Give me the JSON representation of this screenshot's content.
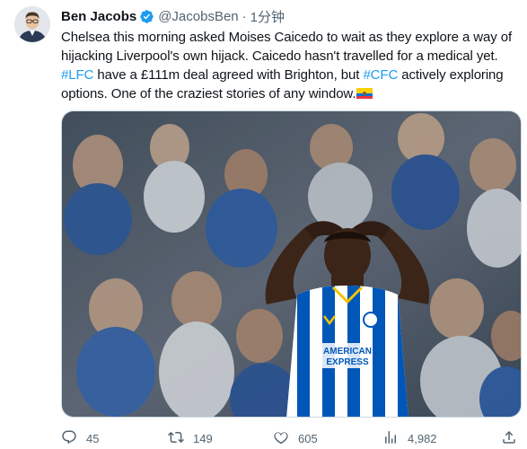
{
  "tweet": {
    "author": {
      "display_name": "Ben Jacobs",
      "handle": "@JacobsBen",
      "separator": "·",
      "timestamp": "1分钟",
      "verified_icon": "verified-badge-icon"
    },
    "text": {
      "part1": "Chelsea this morning asked Moises Caicedo to wait as they explore a way of hijacking Liverpool's own hijack. Caicedo hasn't travelled for a medical yet. ",
      "hashtag1": "#LFC",
      "part2": " have a £111m deal agreed with Brighton, but ",
      "hashtag2": "#CFC",
      "part3": " actively exploring options. One of the craziest stories of any window.",
      "emoji": "ecuador-flag-emoji"
    },
    "media": {
      "shirt_text_line1": "AMERICAN",
      "shirt_text_line2": "EXPRESS"
    },
    "actions": {
      "replies": "45",
      "retweets": "149",
      "likes": "605",
      "views": "4,982"
    }
  },
  "colors": {
    "link": "#1d9bf0",
    "secondary_text": "#536471",
    "primary_text": "#0f1419",
    "verified": "#1d9bf0"
  }
}
